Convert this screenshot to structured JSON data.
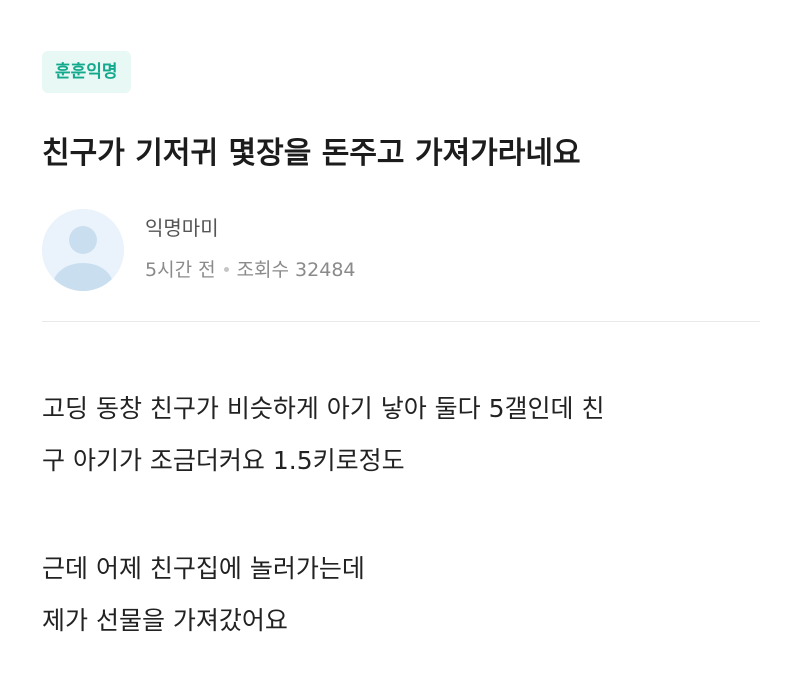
{
  "post": {
    "category": "훈훈익명",
    "title": "친구가 기저귀 몇장을 돈주고 가져가라네요",
    "author": "익명마미",
    "time_ago": "5시간 전",
    "views_label": "조회수 32484",
    "body": {
      "paragraph1": [
        "고딩 동창 친구가 비슷하게 아기 낳아 둘다 5갤인데 친",
        "구 아기가 조금더커요 1.5키로정도"
      ],
      "paragraph2": [
        "근데 어제 친구집에 놀러가는데",
        "제가 선물을 가져갔어요"
      ]
    }
  },
  "colors": {
    "badge_text": "#13a98c",
    "badge_bg": "#e8f8f5",
    "avatar_bg": "#eaf3fb",
    "avatar_figure": "#c9dff0"
  },
  "icons": {
    "avatar": "default-user-avatar-icon"
  }
}
